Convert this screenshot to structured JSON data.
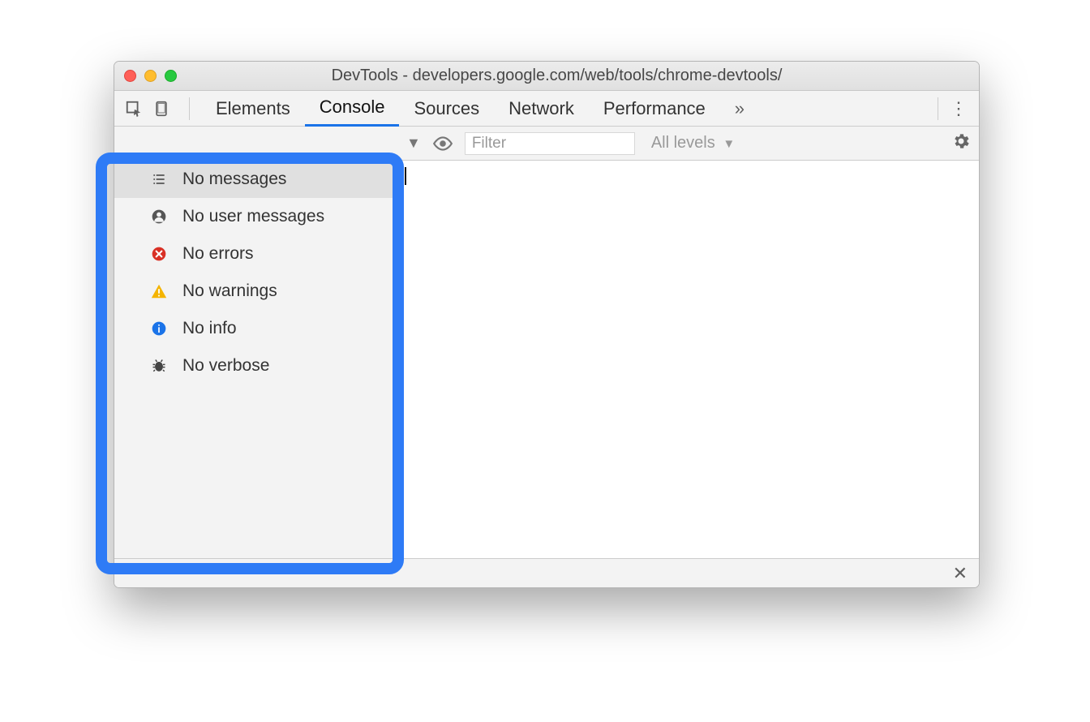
{
  "window": {
    "title": "DevTools - developers.google.com/web/tools/chrome-devtools/"
  },
  "tabs": {
    "items": [
      "Elements",
      "Console",
      "Sources",
      "Network",
      "Performance"
    ],
    "active_index": 1,
    "more_glyph": "»"
  },
  "toolbar": {
    "filter_placeholder": "Filter",
    "filter_value": "",
    "levels_label": "All levels",
    "dropdown_glyph": "▼"
  },
  "sidebar": {
    "items": [
      {
        "icon": "list-icon",
        "label": "No messages"
      },
      {
        "icon": "user-icon",
        "label": "No user messages"
      },
      {
        "icon": "error-icon",
        "label": "No errors"
      },
      {
        "icon": "warning-icon",
        "label": "No warnings"
      },
      {
        "icon": "info-icon",
        "label": "No info"
      },
      {
        "icon": "bug-icon",
        "label": "No verbose"
      }
    ],
    "selected_index": 0
  }
}
